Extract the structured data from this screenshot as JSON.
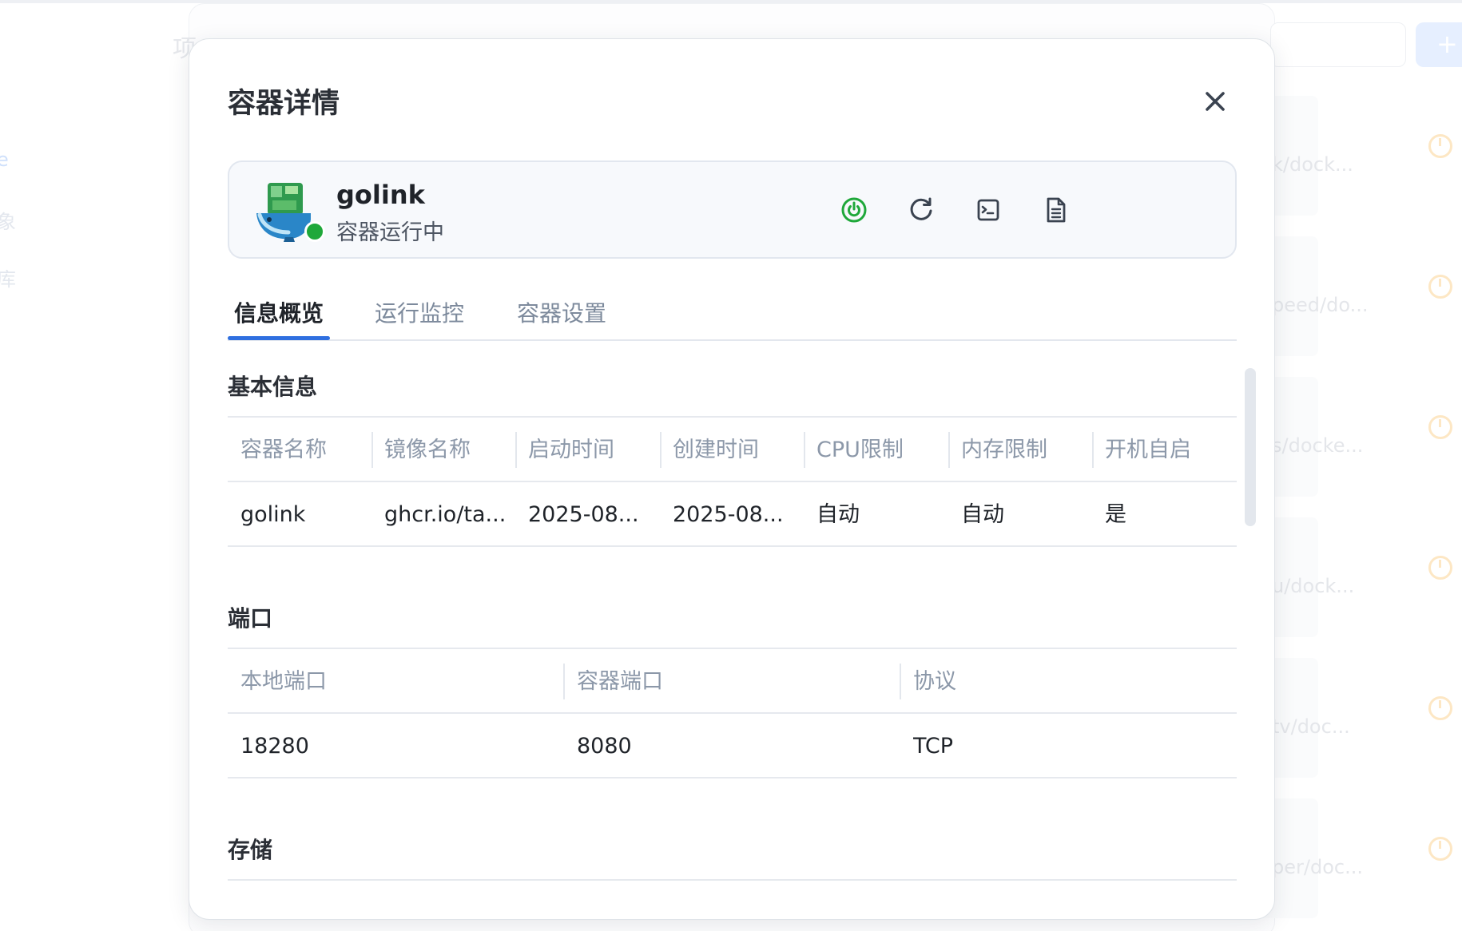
{
  "background": {
    "title_fragment": "项",
    "left_fragments": [
      "e",
      "象",
      "库"
    ],
    "add_button_label": "+",
    "rows": [
      {
        "text": "k/dock..."
      },
      {
        "text": "peed/do..."
      },
      {
        "text": "s/docke..."
      },
      {
        "text": "u/dock..."
      },
      {
        "text": "tv/doc..."
      },
      {
        "text": "per/doc..."
      }
    ]
  },
  "modal": {
    "title": "容器详情",
    "close_icon": "close-icon"
  },
  "container": {
    "name": "golink",
    "status_text": "容器运行中",
    "status_color": "#1fa83a",
    "logo_icon": "docker-whale-icon",
    "actions": [
      {
        "name": "power-button",
        "icon": "power-icon",
        "color": "#1fa83a"
      },
      {
        "name": "restart-button",
        "icon": "refresh-icon",
        "color": "#3a4350"
      },
      {
        "name": "terminal-button",
        "icon": "terminal-icon",
        "color": "#3a4350"
      },
      {
        "name": "logs-button",
        "icon": "document-icon",
        "color": "#3a4350"
      }
    ]
  },
  "tabs": [
    {
      "label": "信息概览",
      "active": true
    },
    {
      "label": "运行监控",
      "active": false
    },
    {
      "label": "容器设置",
      "active": false
    }
  ],
  "accent_color": "#2f6fe0",
  "sections": {
    "basic": {
      "title": "基本信息",
      "headers": [
        "容器名称",
        "镜像名称",
        "启动时间",
        "创建时间",
        "CPU限制",
        "内存限制",
        "开机自启"
      ],
      "row": [
        "golink",
        "ghcr.io/ta...",
        "2025-08...",
        "2025-08...",
        "自动",
        "自动",
        "是"
      ]
    },
    "ports": {
      "title": "端口",
      "headers": [
        "本地端口",
        "容器端口",
        "协议"
      ],
      "row": [
        "18280",
        "8080",
        "TCP"
      ]
    },
    "storage": {
      "title": "存储"
    }
  }
}
